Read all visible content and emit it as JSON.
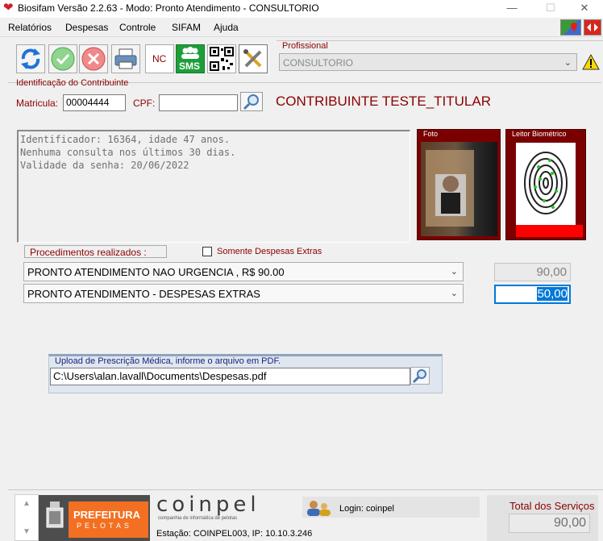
{
  "window": {
    "title": "Biosifam Versão 2.2.63 - Modo: Pronto Atendimento - CONSULTORIO",
    "minimize": "—",
    "maximize": "☐",
    "close": "✕"
  },
  "menu": [
    "Relatórios",
    "Despesas",
    "Controle",
    "SIFAM",
    "Ajuda"
  ],
  "toolbar": {
    "nc_label": "NC",
    "sms_label": "SMS"
  },
  "profissional": {
    "label": "Profissional",
    "value": "CONSULTORIO"
  },
  "contribuinte": {
    "group_label": "Identificação do Contribuinte",
    "matricula_label": "Matricula:",
    "matricula_value": "00004444",
    "cpf_label": "CPF:",
    "cpf_value": "",
    "name": "CONTRIBUINTE TESTE_TITULAR"
  },
  "info": {
    "line1": "Identificador: 16364, idade 47 anos.",
    "line2": "Nenhuma consulta nos últimos 30 dias.",
    "line3": "Validade da senha: 20/06/2022"
  },
  "foto": {
    "label": "Foto"
  },
  "leitor": {
    "label": "Leitor Biométrico"
  },
  "procedimentos": {
    "label": "Procedimentos realizados :",
    "somente_label": "Somente Despesas Extras",
    "items": [
      {
        "name": "PRONTO ATENDIMENTO NAO URGENCIA , R$ 90.00",
        "value": "90,00"
      },
      {
        "name": "PRONTO ATENDIMENTO - DESPESAS EXTRAS",
        "value": "50,00"
      }
    ]
  },
  "upload": {
    "label": "Upload de Prescrição Médica, informe o arquivo em PDF.",
    "path": "C:\\Users\\alan.lavall\\Documents\\Despesas.pdf"
  },
  "footer": {
    "prefeitura_line1": "PREFEITURA",
    "prefeitura_line2": "PELOTAS",
    "coinpel_logo": "coinpel",
    "coinpel_sub": "companhia de informática de pelotas",
    "login": "Login: coinpel",
    "estacao": "Estação: COINPEL003, IP: 10.10.3.246",
    "total_label": "Total dos Serviços",
    "total_value": "90,00"
  },
  "colors": {
    "accent_red": "#8b0000",
    "panel_red": "#7a0000",
    "selection_blue": "#0078d7",
    "sms_green": "#1e9e3a"
  }
}
